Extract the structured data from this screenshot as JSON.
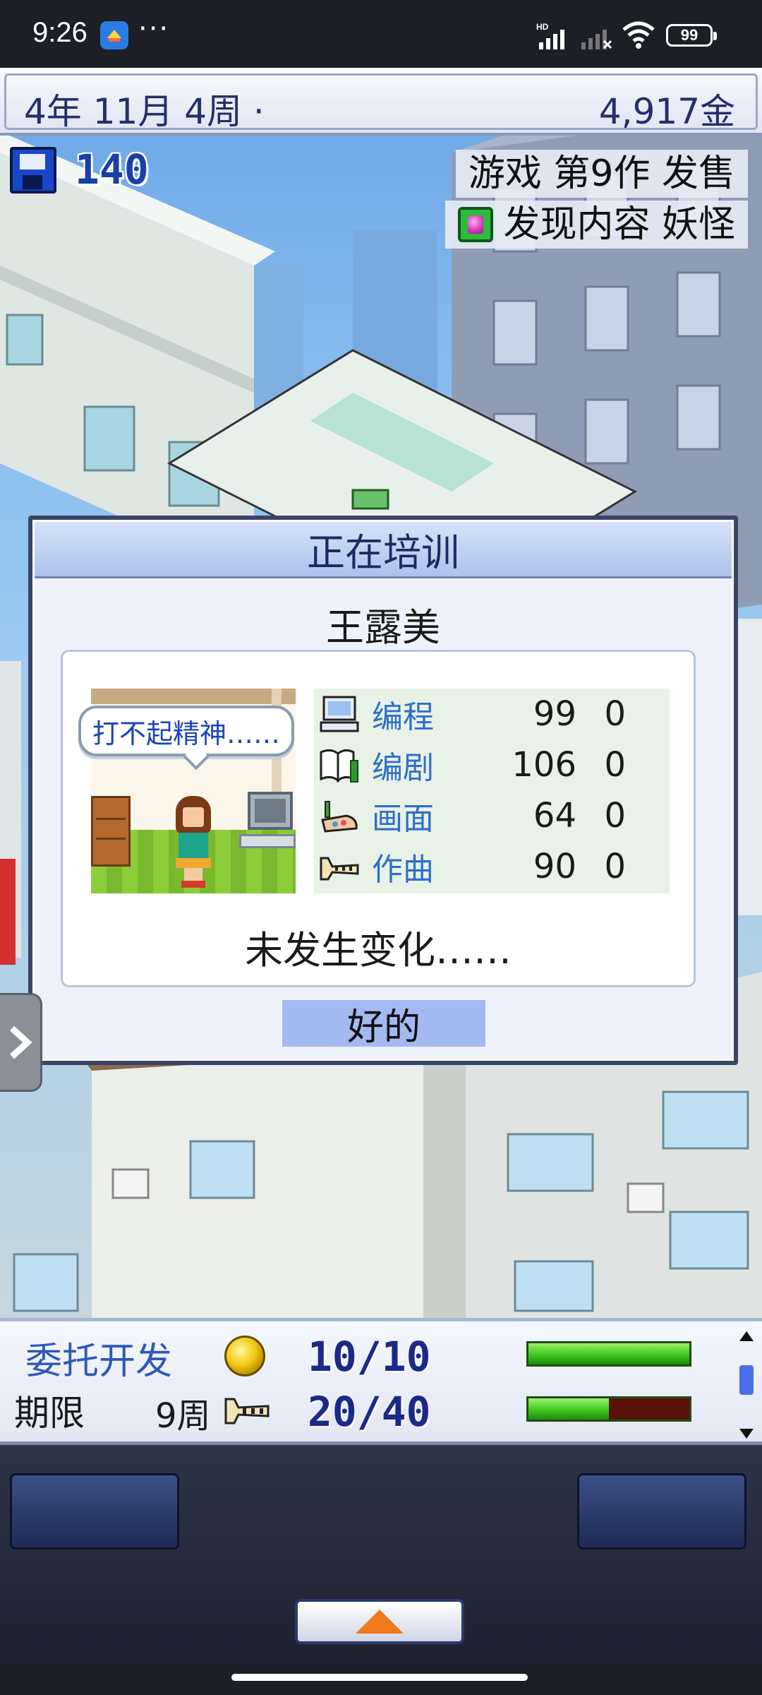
{
  "status_bar": {
    "time": "9:26",
    "more": "···",
    "battery": "99"
  },
  "top_bar": {
    "date": "4年 11月 4周 ·",
    "money": "4,917金"
  },
  "hud": {
    "save_count": "140",
    "notice_release": "游戏 第9作 发售",
    "notice_content": "发现内容 妖怪"
  },
  "dialog": {
    "title": "正在培训",
    "trainee_name": "王露美",
    "speech": "打不起精神……",
    "stats": [
      {
        "name": "编程",
        "value": "99",
        "delta": "0",
        "icon": "computer-icon"
      },
      {
        "name": "编剧",
        "value": "106",
        "delta": "0",
        "icon": "book-icon"
      },
      {
        "name": "画面",
        "value": "64",
        "delta": "0",
        "icon": "paint-icon"
      },
      {
        "name": "作曲",
        "value": "90",
        "delta": "0",
        "icon": "music-icon"
      }
    ],
    "result": "未发生变化……",
    "ok_label": "好的"
  },
  "bottom_panel": {
    "contract_label": "委托开发",
    "deadline_label": "期限",
    "deadline_value": "9周",
    "ratio_1": "10/10",
    "ratio_2": "20/40",
    "progress_1": 1.0,
    "progress_2": 0.5
  },
  "colors": {
    "accent_blue": "#2f6fc8",
    "dialog_title": "#1d2a62",
    "progress_green": "#38c21a",
    "ok_button": "#a4b8f2"
  }
}
